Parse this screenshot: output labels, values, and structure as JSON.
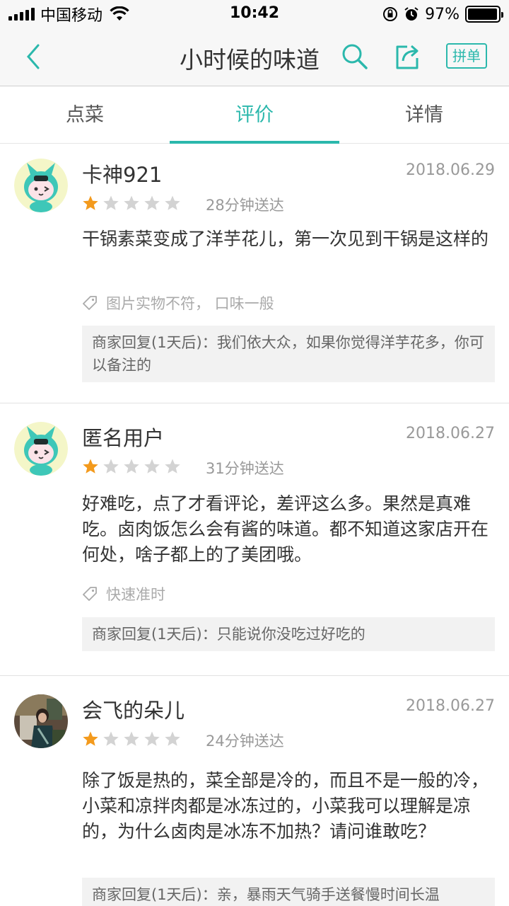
{
  "status_bar": {
    "carrier": "中国移动",
    "time": "10:42",
    "battery_percent": "97%",
    "battery_level": 0.97
  },
  "nav": {
    "title": "小时候的味道",
    "pin_label": "拼单"
  },
  "tabs": [
    {
      "label": "点菜",
      "active": false
    },
    {
      "label": "评价",
      "active": true
    },
    {
      "label": "详情",
      "active": false
    }
  ],
  "colors": {
    "accent": "#2bb8ac",
    "star_on": "#f39a1d",
    "star_off": "#d3d3d3"
  },
  "reviews": [
    {
      "username": "卡神921",
      "date": "2018.06.29",
      "rating": 1,
      "delivery": "28分钟送达",
      "content": "干锅素菜变成了洋芋花儿，第一次见到干锅是这样的",
      "tags": "图片实物不符，  口味一般",
      "reply": "商家回复(1天后)：我们依大众，如果你觉得洋芋花多，你可以备注的",
      "avatar": "cartoon-avatar"
    },
    {
      "username": "匿名用户",
      "date": "2018.06.27",
      "rating": 1,
      "delivery": "31分钟送达",
      "content": "好难吃，点了才看评论，差评这么多。果然是真难吃。卤肉饭怎么会有酱的味道。都不知道这家店开在何处，啥子都上的了美团哦。",
      "tags": "快速准时",
      "reply": "商家回复(1天后)：只能说你没吃过好吃的",
      "avatar": "cartoon-avatar"
    },
    {
      "username": "会飞的朵儿",
      "date": "2018.06.27",
      "rating": 1,
      "delivery": "24分钟送达",
      "content": "除了饭是热的，菜全部是冷的，而且不是一般的冷，小菜和凉拌肉都是冰冻过的，小菜我可以理解是凉的，为什么卤肉是冰冻不加热？请问谁敢吃？",
      "tags": "",
      "reply": "商家回复(1天后)：亲，暴雨天气骑手送餐慢时间长温",
      "avatar": "photo-avatar"
    }
  ]
}
